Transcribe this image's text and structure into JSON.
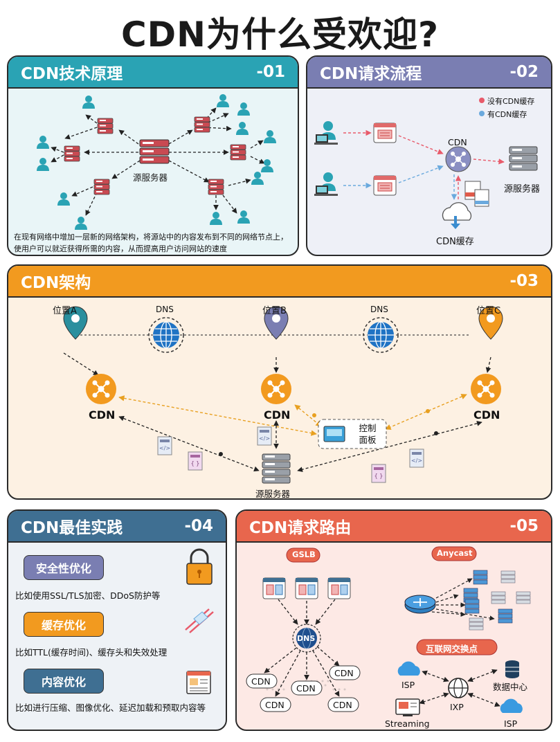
{
  "title": "CDN为什么受欢迎?",
  "colors": {
    "p1": "#2aa3b4",
    "p2": "#7a7eb2",
    "p3": "#f29a1f",
    "p4": "#3f6f92",
    "p5": "#e8664d"
  },
  "p1": {
    "title": "CDN技术原理",
    "num": "-01",
    "center_label": "源服务器",
    "desc": "在现有网络中增加一层新的网络架构，将源站中的内容发布到不同的网络节点上，使用户可以就近获得所需的内容，从而提高用户访问网站的速度"
  },
  "p2": {
    "title": "CDN请求流程",
    "num": "-02",
    "legend_no_cache": "没有CDN缓存",
    "legend_cache": "有CDN缓存",
    "cdn_label": "CDN",
    "origin_label": "源服务器",
    "cache_label": "CDN缓存"
  },
  "p3": {
    "title": "CDN架构",
    "num": "-03",
    "loc_a": "位置A",
    "loc_b": "位置B",
    "loc_c": "位置C",
    "dns": "DNS",
    "cdn": "CDN",
    "control_panel": "控制\n面板",
    "origin_label": "源服务器"
  },
  "p4": {
    "title": "CDN最佳实践",
    "num": "-04",
    "items": [
      {
        "label": "安全性优化",
        "desc": "比如使用SSL/TLS加密、DDoS防护等"
      },
      {
        "label": "缓存优化",
        "desc": "比如TTL(缓存时间)、缓存头和失效处理"
      },
      {
        "label": "内容优化",
        "desc": "比如进行压缩、图像优化、延迟加载和预取内容等"
      }
    ]
  },
  "p5": {
    "title": "CDN请求路由",
    "num": "-05",
    "gslb": "GSLB",
    "anycast": "Anycast",
    "dns": "DNS",
    "cdn": "CDN",
    "ixp_title": "互联网交换点",
    "isp": "ISP",
    "data_center": "数据中心",
    "ixp": "IXP",
    "streaming": "Streaming"
  },
  "icons": [
    "user-icon",
    "server-icon",
    "browser-icon",
    "cloud-icon",
    "globe-icon",
    "location-pin-icon",
    "cdn-hub-icon",
    "lock-icon",
    "router-icon",
    "database-icon",
    "html-file-icon",
    "css-file-icon"
  ]
}
